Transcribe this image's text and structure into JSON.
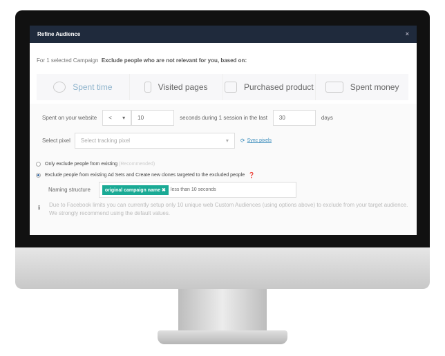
{
  "modal": {
    "title": "Refine Audience",
    "close": "×"
  },
  "intro": {
    "prefix": "For 1 selected Campaign",
    "text": "Exclude people who are not relevant for you, based on:"
  },
  "tabs": [
    {
      "label": "Spent time",
      "icon": "clock-icon",
      "active": true
    },
    {
      "label": "Visited pages",
      "icon": "hand-pointer-icon",
      "active": false
    },
    {
      "label": "Purchased product",
      "icon": "basket-icon",
      "active": false
    },
    {
      "label": "Spent money",
      "icon": "money-icon",
      "active": false
    }
  ],
  "spent": {
    "label": "Spent on your website",
    "operator": "<",
    "seconds": "10",
    "middle": "seconds during 1 session in the last",
    "days": "30",
    "suffix": "days"
  },
  "pixel": {
    "label": "Select pixel",
    "placeholder": "Select tracking pixel",
    "sync": "Sync pixels"
  },
  "options": [
    {
      "label": "Only exclude people from existing",
      "note": "(Recommended)",
      "selected": false
    },
    {
      "label": "Exclude people from existing Ad Sets and Create new clones targeted to the excluded people",
      "selected": true
    }
  ],
  "naming": {
    "label": "Naming structure",
    "chip": "original campaign name",
    "text": "less than 10 seconds"
  },
  "info": "Due to Facebook limits you can currently setup only 10 unique web Custom Audiences (using options above) to exclude from your target audience. We strongly recommend using the default values.",
  "colors": {
    "header": "#1f2a3c",
    "chip": "#1aaa95",
    "link": "#3c8dbc"
  }
}
